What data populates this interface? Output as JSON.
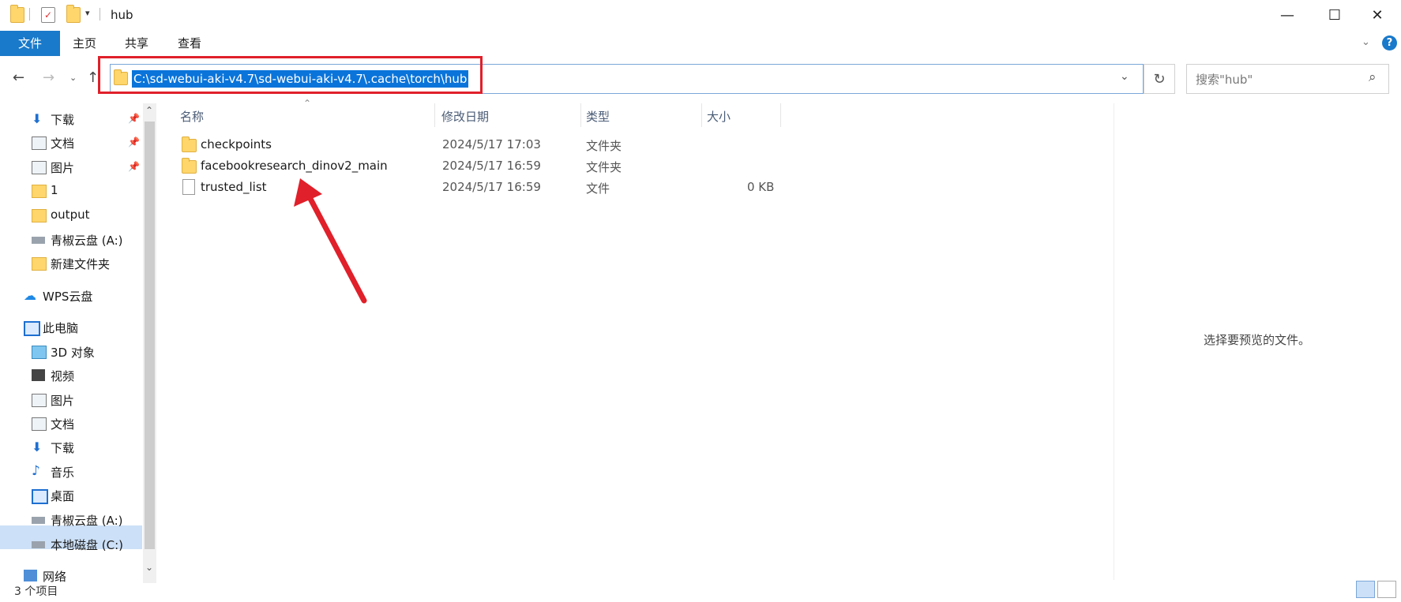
{
  "window": {
    "title": "hub",
    "controls": {
      "minimize": "—",
      "maximize": "☐",
      "close": "✕"
    }
  },
  "ribbon": {
    "tabs": [
      "文件",
      "主页",
      "共享",
      "查看"
    ]
  },
  "address_bar": {
    "path": "C:\\sd-webui-aki-v4.7\\sd-webui-aki-v4.7\\.cache\\torch\\hub"
  },
  "search": {
    "placeholder": "搜索\"hub\""
  },
  "nav_pane": {
    "items": [
      {
        "label": "下载",
        "icon": "download-arrow-icon",
        "pinned": true
      },
      {
        "label": "文档",
        "icon": "document-icon",
        "pinned": true
      },
      {
        "label": "图片",
        "icon": "pictures-icon",
        "pinned": true
      },
      {
        "label": "1",
        "icon": "folder-icon"
      },
      {
        "label": "output",
        "icon": "folder-icon"
      },
      {
        "label": "青椒云盘 (A:)",
        "icon": "network-drive-icon"
      },
      {
        "label": "新建文件夹",
        "icon": "folder-icon"
      },
      {
        "label": "WPS云盘",
        "icon": "cloud-icon"
      },
      {
        "label": "此电脑",
        "icon": "computer-icon"
      },
      {
        "label": "3D 对象",
        "icon": "3d-objects-icon"
      },
      {
        "label": "视频",
        "icon": "video-icon"
      },
      {
        "label": "图片",
        "icon": "pictures-icon"
      },
      {
        "label": "文档",
        "icon": "document-icon"
      },
      {
        "label": "下载",
        "icon": "download-arrow-icon"
      },
      {
        "label": "音乐",
        "icon": "music-icon"
      },
      {
        "label": "桌面",
        "icon": "desktop-icon"
      },
      {
        "label": "青椒云盘 (A:)",
        "icon": "network-drive-icon"
      },
      {
        "label": "本地磁盘 (C:)",
        "icon": "local-disk-icon",
        "selected": true
      },
      {
        "label": "网络",
        "icon": "network-icon"
      }
    ]
  },
  "file_list": {
    "columns": [
      "名称",
      "修改日期",
      "类型",
      "大小"
    ],
    "rows": [
      {
        "name": "checkpoints",
        "modified": "2024/5/17 17:03",
        "type": "文件夹",
        "size": "",
        "icon": "folder-icon"
      },
      {
        "name": "facebookresearch_dinov2_main",
        "modified": "2024/5/17 16:59",
        "type": "文件夹",
        "size": "",
        "icon": "folder-icon"
      },
      {
        "name": "trusted_list",
        "modified": "2024/5/17 16:59",
        "type": "文件",
        "size": "0 KB",
        "icon": "file-icon"
      }
    ]
  },
  "preview_pane": {
    "message": "选择要预览的文件。"
  },
  "status_bar": {
    "item_count": "3 个项目"
  },
  "colors": {
    "accent": "#1979ca",
    "selection": "#0a74da",
    "annotation_red": "#e0202a",
    "folder_yellow": "#ffd66b"
  }
}
